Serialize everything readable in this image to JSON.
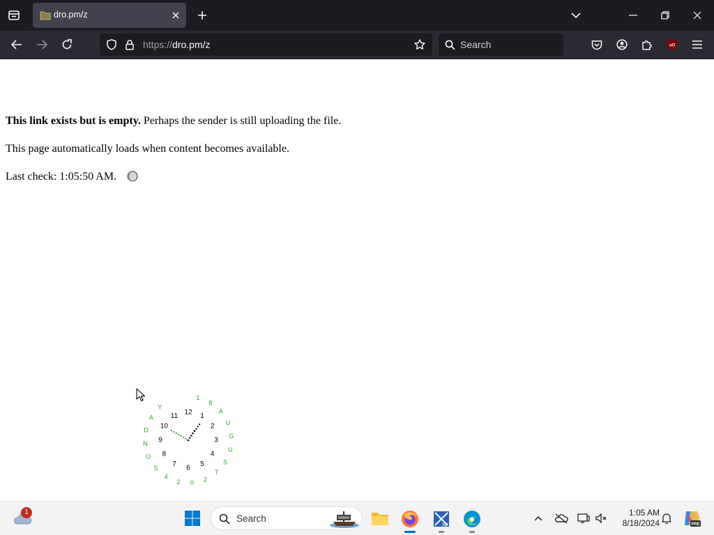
{
  "browser": {
    "tab": {
      "title": "dro.pm/z"
    },
    "url": {
      "scheme": "https://",
      "host_path": "dro.pm/z"
    },
    "search": {
      "placeholder": "Search"
    },
    "extension_badge": "uO"
  },
  "page": {
    "message_bold": "This link exists but is empty.",
    "message_rest": " Perhaps the sender is still uploading the file.",
    "autoload_text": "This page automatically loads when content becomes available.",
    "last_check_prefix": "Last check: ",
    "last_check_time": "1:05:50 AM.",
    "clock": {
      "hours": [
        "12",
        "1",
        "2",
        "3",
        "4",
        "5",
        "6",
        "7",
        "8",
        "9",
        "10",
        "11"
      ],
      "month_letters": [
        "A",
        "U",
        "G",
        "U",
        "S",
        "T"
      ],
      "day_letters": [
        "S",
        "U",
        "N",
        "D",
        "A",
        "Y"
      ],
      "year_digits": [
        "2",
        "0",
        "2",
        "4"
      ],
      "date_digits": [
        "1",
        "8"
      ],
      "colors": {
        "numbers": "#000000",
        "date_text": "#2e9e2e",
        "second_hand": "#2e9e2e"
      },
      "time": {
        "hour": 1,
        "minute": 5,
        "second": 50
      }
    }
  },
  "taskbar": {
    "search_label": "Search",
    "weather_badge": "1",
    "time": "1:05 AM",
    "date": "8/18/2024",
    "copilot_label": "PRE"
  }
}
